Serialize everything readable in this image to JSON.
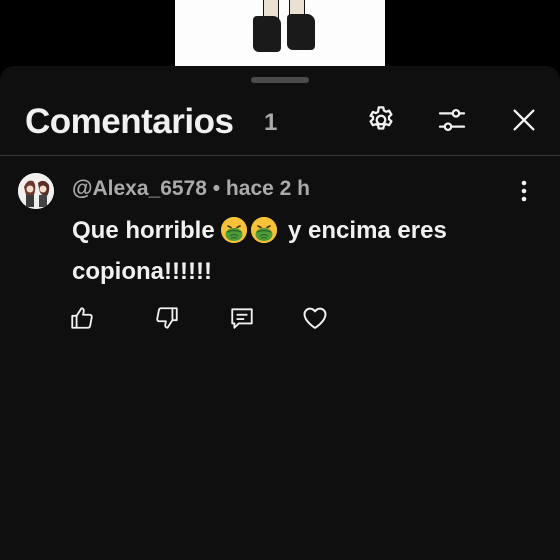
{
  "header": {
    "title": "Comentarios",
    "count": "1"
  },
  "comment": {
    "meta": "@Alexa_6578 • hace 2 h",
    "text_part1": "Que horrible ",
    "text_part2": " y encima eres copiona!!!!!!",
    "emojis": [
      "nauseated-face-emoji",
      "nauseated-face-emoji"
    ]
  },
  "icons": {
    "settings": "gear-icon",
    "filter": "sliders-icon",
    "close": "close-icon",
    "more": "vertical-dots-icon",
    "like": "thumbs-up-icon",
    "dislike": "thumbs-down-icon",
    "reply": "comment-icon",
    "heart": "heart-icon"
  },
  "colors": {
    "background": "#0f0f0f",
    "text": "#f1f1f1",
    "secondary_text": "#aaaaaa"
  }
}
